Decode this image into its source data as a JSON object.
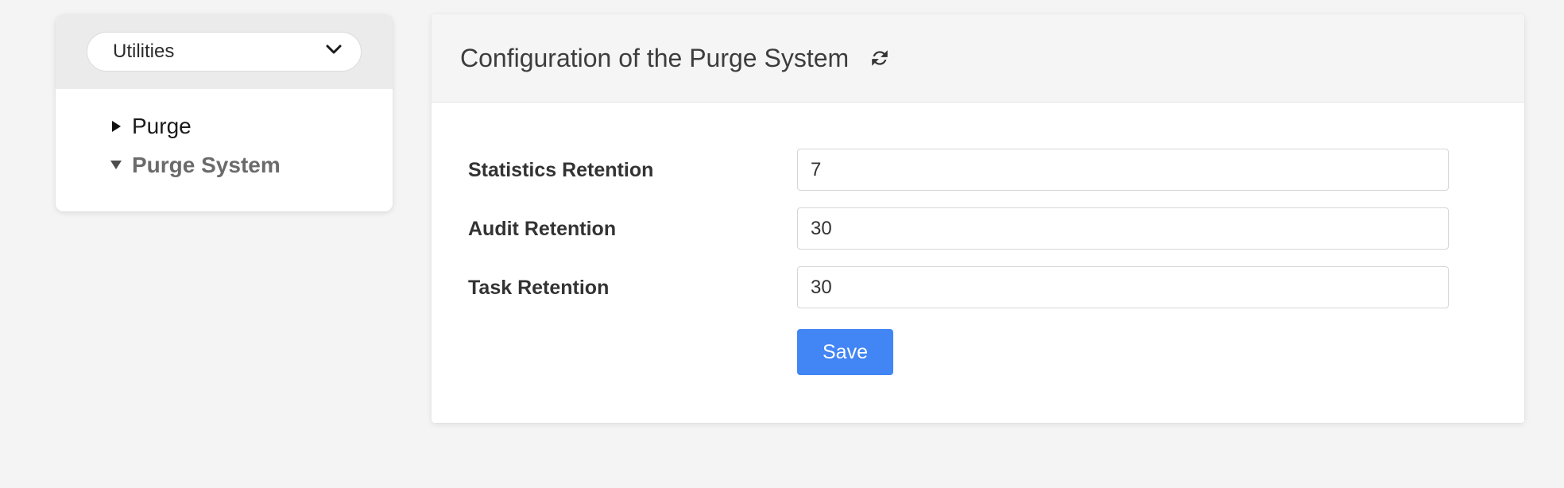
{
  "page": {
    "background_color": "#f4f4f4"
  },
  "sidebar": {
    "selector": {
      "value": "Utilities",
      "chevron_icon": "chevron-down-icon"
    },
    "tree_items": [
      {
        "label": "Purge",
        "expanded": false,
        "toggle_icon": "triangle-right-icon",
        "active": false
      },
      {
        "label": "Purge System",
        "expanded": true,
        "toggle_icon": "triangle-down-icon",
        "active": true
      }
    ]
  },
  "main": {
    "header": {
      "title": "Configuration of the Purge System",
      "refresh_icon": "refresh-icon"
    },
    "form": {
      "fields": [
        {
          "label": "Statistics Retention",
          "value": "7",
          "placeholder": ""
        },
        {
          "label": "Audit Retention",
          "value": "30",
          "placeholder": ""
        },
        {
          "label": "Task Retention",
          "value": "30",
          "placeholder": ""
        }
      ],
      "save_label": "Save",
      "save_color": "#4285f4"
    }
  }
}
